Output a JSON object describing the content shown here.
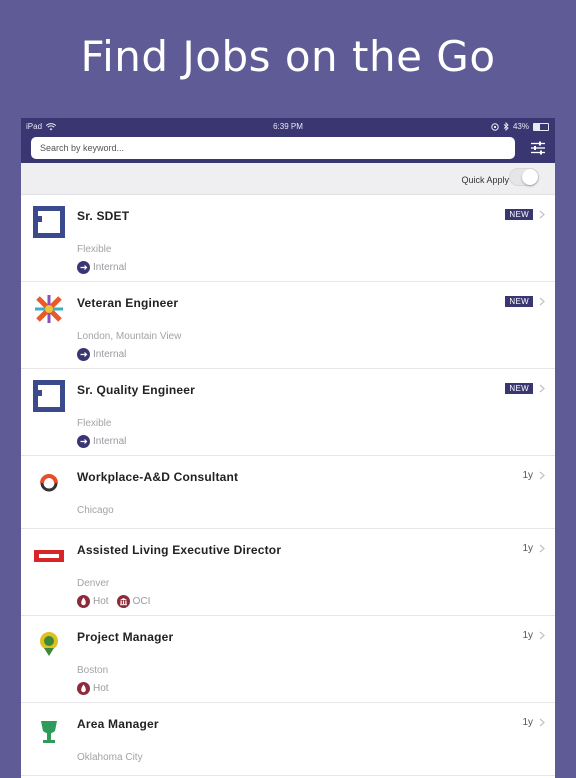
{
  "hero": {
    "title": "Find Jobs on the Go"
  },
  "status_bar": {
    "device": "iPad",
    "time": "6:39 PM",
    "battery": "43%",
    "battery_level": 0.43
  },
  "search": {
    "placeholder": "Search by keyword..."
  },
  "filter": {
    "icon": "sliders-icon"
  },
  "quick_apply": {
    "label": "Quick Apply",
    "on": false
  },
  "colors": {
    "accent": "#3a3672",
    "background": "#5f5b96"
  },
  "jobs": [
    {
      "title": "Sr. SDET",
      "location": "Flexible",
      "badge": "NEW",
      "age": "",
      "tags": [
        {
          "label": "Internal",
          "icon": "internal-icon"
        }
      ],
      "logo": "square-logo"
    },
    {
      "title": "Veteran Engineer",
      "location": "London, Mountain View",
      "badge": "NEW",
      "age": "",
      "tags": [
        {
          "label": "Internal",
          "icon": "internal-icon"
        }
      ],
      "logo": "star-logo"
    },
    {
      "title": "Sr. Quality Engineer",
      "location": "Flexible",
      "badge": "NEW",
      "age": "",
      "tags": [
        {
          "label": "Internal",
          "icon": "internal-icon"
        }
      ],
      "logo": "square-logo"
    },
    {
      "title": "Workplace-A&D Consultant",
      "location": "Chicago",
      "badge": "",
      "age": "1y",
      "tags": [],
      "logo": "swirl-logo"
    },
    {
      "title": "Assisted Living Executive Director",
      "location": "Denver",
      "badge": "",
      "age": "1y",
      "tags": [
        {
          "label": "Hot",
          "icon": "flame-icon"
        },
        {
          "label": "OCI",
          "icon": "building-icon"
        }
      ],
      "logo": "red-bar-logo"
    },
    {
      "title": "Project Manager",
      "location": "Boston",
      "badge": "",
      "age": "1y",
      "tags": [
        {
          "label": "Hot",
          "icon": "flame-icon"
        }
      ],
      "logo": "pin-logo"
    },
    {
      "title": "Area Manager",
      "location": "Oklahoma City",
      "badge": "",
      "age": "1y",
      "tags": [],
      "logo": "trophy-logo"
    }
  ]
}
